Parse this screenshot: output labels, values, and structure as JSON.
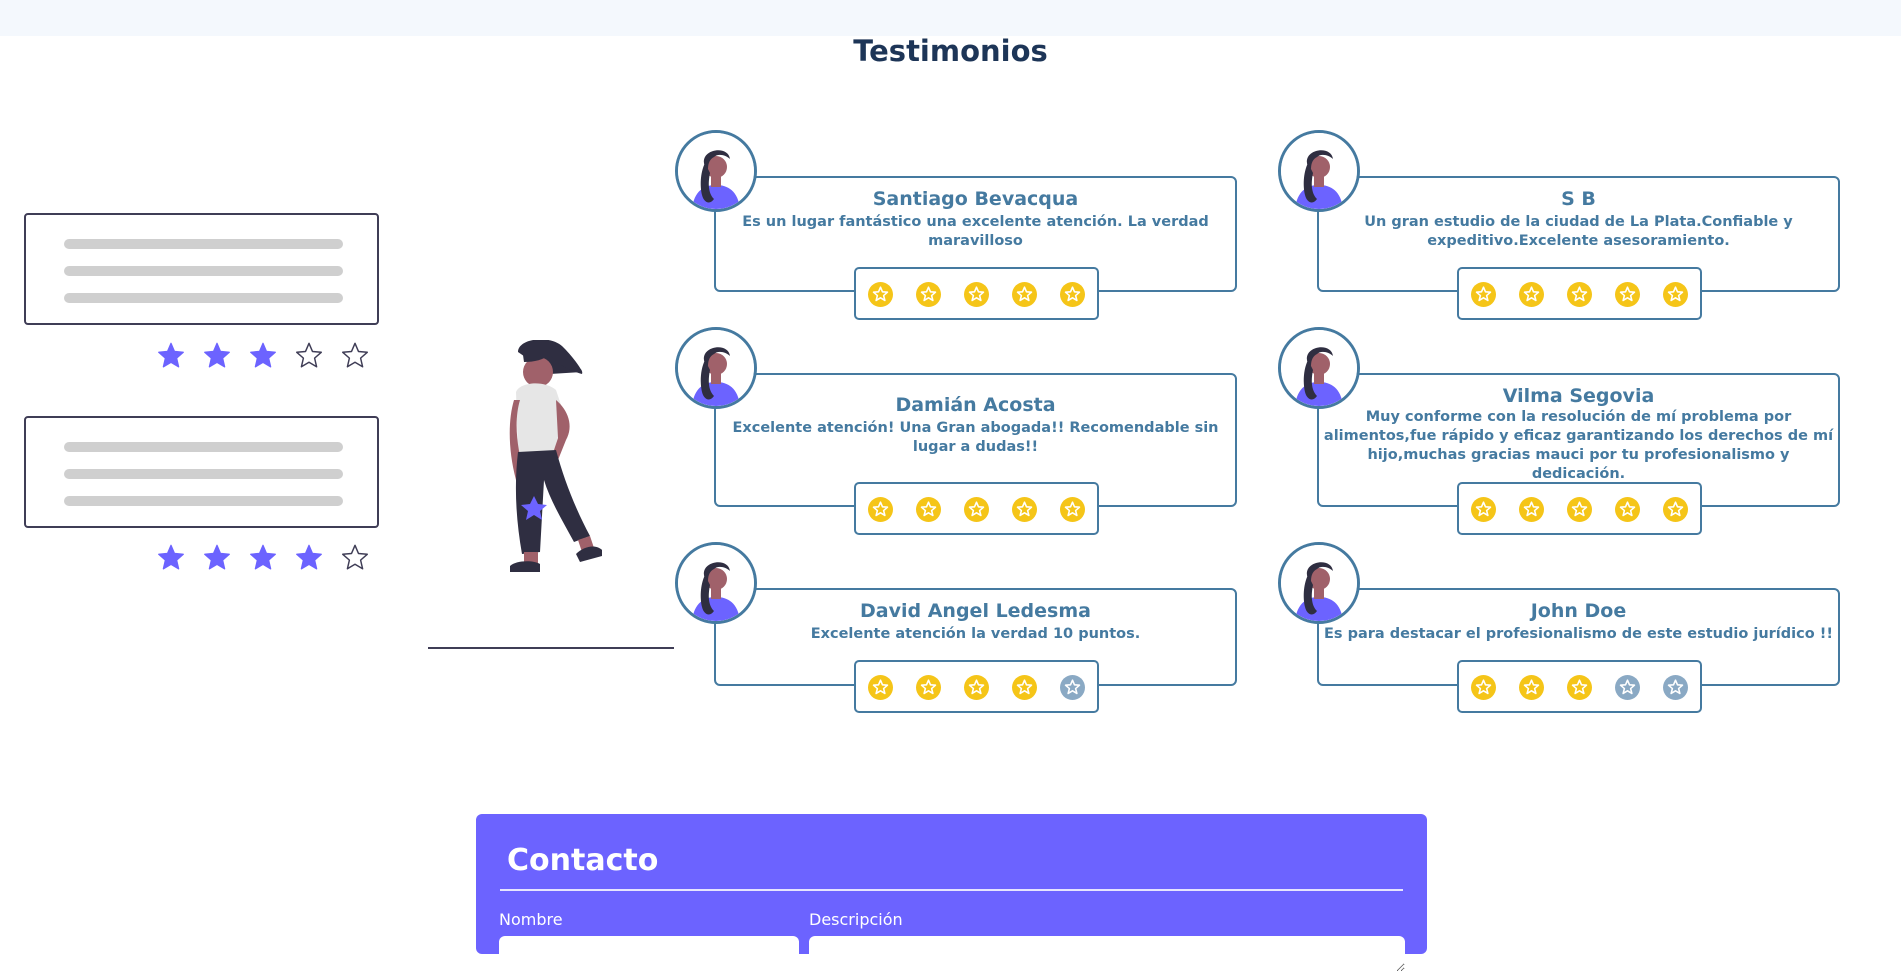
{
  "section_title": "Testimonios",
  "colors": {
    "accent": "#6c63ff",
    "card_border": "#457aa0",
    "title": "#1d3557",
    "star_filled": "#f5c518",
    "star_empty": "#8aa9c4"
  },
  "illustration": {
    "review_cards": [
      {
        "stars_filled": 3,
        "stars_total": 5
      },
      {
        "stars_filled": 4,
        "stars_total": 5
      }
    ]
  },
  "testimonials": [
    {
      "name": "Santiago Bevacqua",
      "text": "Es un lugar fantástico una excelente atención. La verdad maravilloso",
      "rating": 5
    },
    {
      "name": "S B",
      "text": "Un gran estudio de la ciudad de La Plata.Confiable y expeditivo.Excelente asesoramiento.",
      "rating": 5
    },
    {
      "name": "Damián Acosta",
      "text": "Excelente atención! Una Gran abogada!! Recomendable sin lugar a dudas!!",
      "rating": 5
    },
    {
      "name": "Vilma Segovia",
      "text": "Muy conforme con la resolución de mí problema por alimentos,fue rápido y eficaz garantizando los derechos de mí hijo,muchas gracias mauci por tu profesionalismo y dedicación.",
      "rating": 5
    },
    {
      "name": "David Angel Ledesma",
      "text": "Excelente atención la verdad 10 puntos.",
      "rating": 4
    },
    {
      "name": "John Doe",
      "text": "Es para destacar el profesionalismo de este estudio jurídico !!",
      "rating": 3
    }
  ],
  "contact": {
    "title": "Contacto",
    "name_label": "Nombre",
    "description_label": "Descripción"
  }
}
